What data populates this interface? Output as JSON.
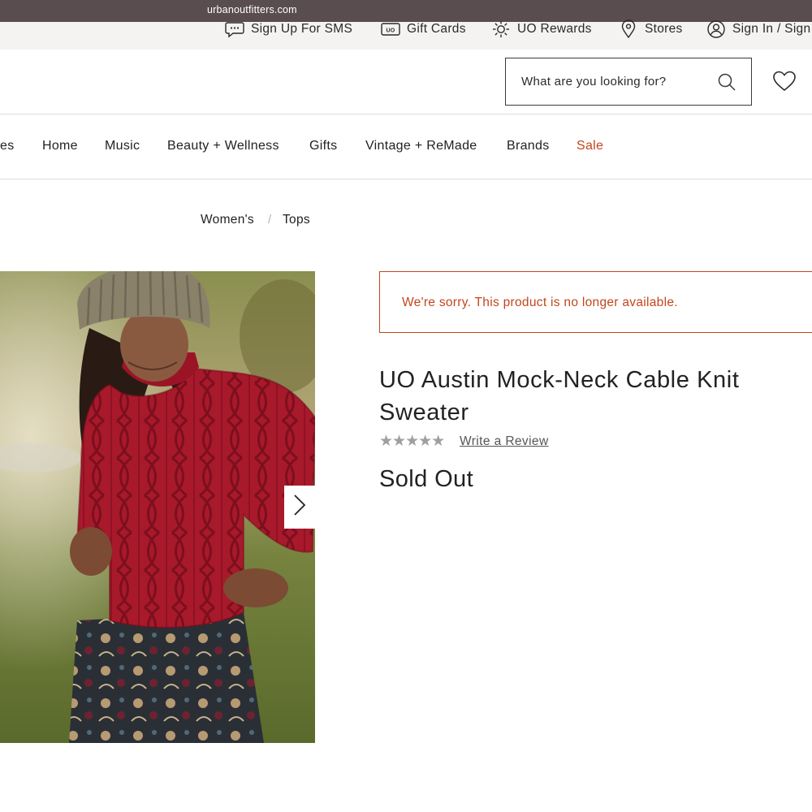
{
  "browser": {
    "url": "urbanoutfitters.com"
  },
  "utility_nav": [
    {
      "label": "Sign Up For SMS",
      "icon": "chat-bubble-icon"
    },
    {
      "label": "Gift Cards",
      "icon": "gift-card-icon"
    },
    {
      "label": "UO Rewards",
      "icon": "sun-icon"
    },
    {
      "label": "Stores",
      "icon": "location-pin-icon"
    },
    {
      "label": "Sign In / Sign",
      "icon": "user-icon"
    }
  ],
  "search": {
    "placeholder": "What are you looking for?"
  },
  "main_nav": [
    {
      "label": "es"
    },
    {
      "label": "Home"
    },
    {
      "label": "Music"
    },
    {
      "label": "Beauty + Wellness"
    },
    {
      "label": "Gifts"
    },
    {
      "label": "Vintage + ReMade"
    },
    {
      "label": "Brands"
    },
    {
      "label": "Sale"
    }
  ],
  "breadcrumb": {
    "items": [
      "Women's",
      "Tops"
    ],
    "separator": "/"
  },
  "product": {
    "alert": "We're sorry. This product is no longer available.",
    "title": "UO Austin Mock-Neck Cable Knit Sweater",
    "stars": "★★★★★",
    "rating_value": 0,
    "review_link": "Write a Review",
    "status": "Sold Out"
  },
  "colors": {
    "accent": "#c2461d",
    "url_bar": "#5a4d4f",
    "utility_bg": "#f4f3f2",
    "sweater": "#a8192b"
  }
}
